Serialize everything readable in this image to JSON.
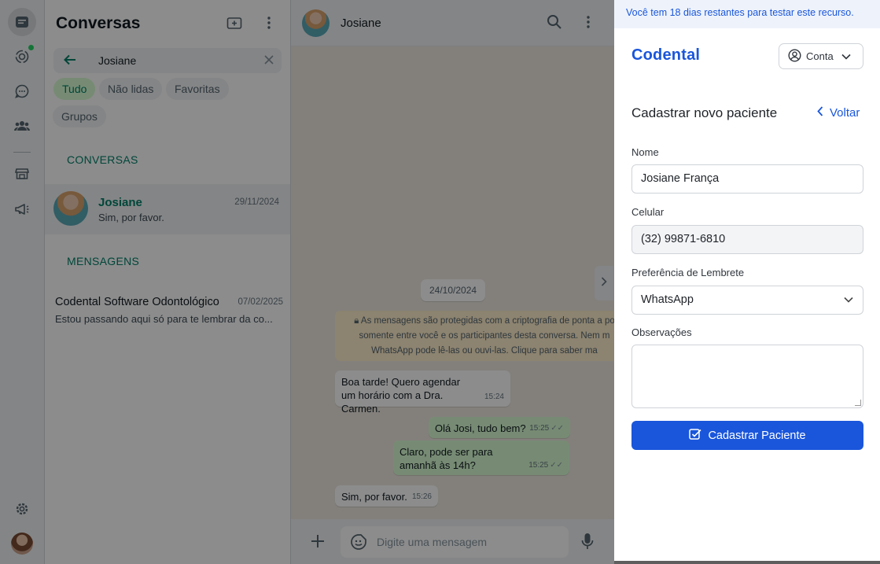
{
  "sidebar": {
    "title": "Conversas",
    "search_value": "Josiane",
    "filters": [
      "Tudo",
      "Não lidas",
      "Favoritas",
      "Grupos"
    ],
    "section_conversations": "CONVERSAS",
    "section_messages": "MENSAGENS",
    "conversation": {
      "name": "Josiane",
      "date": "29/11/2024",
      "preview": "Sim, por favor."
    },
    "message_result": {
      "name": "Codental Software Odontológico",
      "date": "07/02/2025",
      "preview": "Estou passando aqui só para te lembrar da co..."
    }
  },
  "chat": {
    "contact_name": "Josiane",
    "date_pill": "24/10/2024",
    "encryption_lines": [
      "As mensagens são protegidas com a criptografia de ponta a po",
      "somente entre você e os participantes desta conversa. Nem m",
      "WhatsApp pode lê-las ou ouvi-las. Clique para saber ma"
    ],
    "messages": [
      {
        "dir": "in",
        "text": "Boa tarde! Quero agendar um horário com a Dra. Carmen.",
        "time": "15:24"
      },
      {
        "dir": "out",
        "text": "Olá Josi, tudo bem?",
        "time": "15:25"
      },
      {
        "dir": "out",
        "text": "Claro, pode ser para amanhã às 14h?",
        "time": "15:25"
      },
      {
        "dir": "in",
        "text": "Sim, por favor.",
        "time": "15:26"
      }
    ],
    "composer_placeholder": "Digite uma mensagem"
  },
  "extension": {
    "trial_notice": "Você tem 18 dias restantes para testar este recurso.",
    "brand": "Codental",
    "account_label": "Conta",
    "form_title": "Cadastrar novo paciente",
    "back_label": "Voltar",
    "fields": {
      "name_label": "Nome",
      "name_value": "Josiane França",
      "phone_label": "Celular",
      "phone_value": "(32) 99871-6810",
      "reminder_label": "Preferência de Lembrete",
      "reminder_value": "WhatsApp",
      "notes_label": "Observações"
    },
    "submit_label": "Cadastrar Paciente"
  },
  "colors": {
    "accent": "#1a56db",
    "whatsapp_green": "#008069",
    "outgoing_bubble": "#d9fdd3"
  },
  "icons": {
    "rail": [
      "chats-icon",
      "status-icon",
      "channels-icon",
      "communities-icon",
      "catalog-icon",
      "ads-icon",
      "settings-icon"
    ]
  }
}
